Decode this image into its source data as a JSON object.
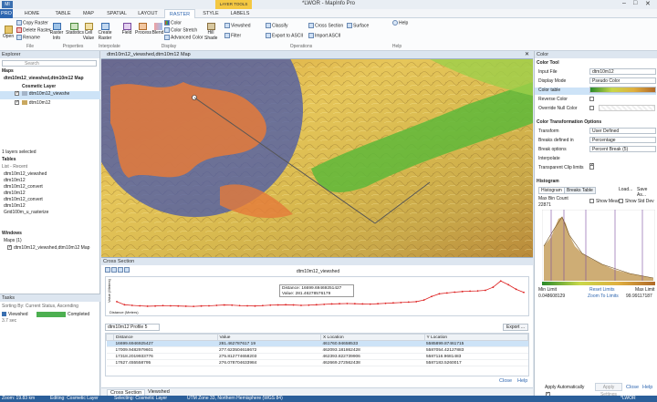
{
  "titlebar": {
    "app": "MI",
    "title": "*LWOR - MapInfo Pro",
    "context": "LAYER TOOLS"
  },
  "tabs": [
    "PRO",
    "HOME",
    "TABLE",
    "MAP",
    "SPATIAL",
    "LAYOUT",
    "RASTER",
    "STYLE",
    "LABELS"
  ],
  "help": "Help",
  "ribbon": {
    "copy": "Copy Raster",
    "delete": "Delete Raster",
    "rename": "Rename",
    "open": "Open",
    "info": "Raster Info",
    "stats": "Statistics",
    "cell": "Cell Value",
    "create": "Create Raster",
    "field": "Field",
    "process": "Process",
    "blend": "Blend",
    "color": "Color",
    "color_stretch": "Color Stretch",
    "advanced_color": "Advanced Color",
    "hill": "Hill Shade",
    "viewshed": "Viewshed",
    "filter": "Filter",
    "classify": "Classify",
    "export_ascii": "Export to ASCII",
    "cross": "Cross Section",
    "import_ascii": "Import ASCII",
    "surface": "Surface",
    "groups": [
      "File",
      "Properties",
      "Interpolate",
      "Display",
      "Operations",
      "Help"
    ]
  },
  "explorer": {
    "title": "Explorer",
    "search": "Search",
    "maps": "Maps",
    "map_name": "dtm10m12_viewshed,dtm10m12 Map",
    "cosmetic": "Cosmetic Layer",
    "layers": [
      "dtm10m12_viewshe",
      "dtm10m12"
    ],
    "selected": "1 layers selected",
    "tables": "Tables",
    "list": "List - Recent",
    "table_items": [
      "dtm10m12_viewshed",
      "dtm10m12",
      "dtm10m12_convert",
      "dtm10m12",
      "dtm10m12_convert",
      "dtm10m12",
      "Grid100m_u_rasterize"
    ],
    "windows": "Windows",
    "maps_count": "Maps (1)",
    "window_item": "dtm10m12_viewshed,dtm10m12 Map"
  },
  "tasks": {
    "title": "Tasks",
    "sort": "Sorting By: Current Status, Ascending",
    "name": "Viewshed",
    "time": "3.7 sec",
    "status": "Completed"
  },
  "map": {
    "tab": "dtm10m12_viewshed,dtm10m12 Map"
  },
  "cross": {
    "title": "Cross Section",
    "chart_title": "dtm10m12_viewshed",
    "ylabel": "Value (Metres)",
    "xlabel": "Distance (Meters)",
    "distance": "Distance: 16699.69469251427",
    "value": "Value: 281.46278576179",
    "profile": "dtm10m12 Profile 5",
    "export": "Export ...",
    "columns": [
      "Distance",
      "Value",
      "X Location",
      "Y Location"
    ],
    "rows": [
      [
        "16699.6946925427",
        "281.462787617 19",
        "461760.94658533",
        "5585899.87461715"
      ],
      [
        "17009.9482979601",
        "277.623504618672",
        "462093.181862428",
        "5587054.42127883"
      ],
      [
        "17318.2019933776",
        "275.812774658203",
        "462393.822739906",
        "5587116.9681483"
      ],
      [
        "17627.455558795",
        "276.078704633984",
        "462669.272562438",
        "5587183.5260017"
      ]
    ],
    "close": "Close",
    "help": "Help",
    "tab1": "Cross Section",
    "tab2": "Viewshed"
  },
  "color": {
    "title": "Color",
    "tool": "Color Tool",
    "input_file_label": "Input File",
    "input_file": "dtm10m12",
    "display_mode_label": "Display Mode",
    "display_mode": "Pseudo Color",
    "color_table_label": "Color table",
    "reverse_label": "Reverse Color",
    "override_label": "Override Null Color",
    "transform_section": "Color Transformation Options",
    "transform_label": "Transform",
    "transform": "User Defined",
    "breaks_label": "Breaks defined in",
    "breaks": "Percentage",
    "break_opts_label": "Break options",
    "break_opts": "Percent Break (5)",
    "interpolate_label": "Interpolate",
    "transparent_label": "Transparent Clip limits",
    "histogram_section": "Histogram",
    "hist_tab1": "Histogram",
    "hist_tab2": "Breaks Table",
    "load": "Load...",
    "save": "Save As...",
    "max_bin_label": "Max Bin Count",
    "max_bin": "22871",
    "show_mean": "Show Mean",
    "show_std": "Show Std Dev",
    "min_limit_label": "Min Limit",
    "min_limit": "0.048608129",
    "max_limit_label": "Max Limit",
    "max_limit": "99.99117187",
    "reset": "Reset Limits",
    "zoom": "Zoom To Limits",
    "apply_auto": "Apply Automatically",
    "apply": "Apply Settings",
    "close": "Close",
    "help": "Help"
  },
  "status": {
    "zoom": "Zoom: 19.83 km",
    "editing": "Editing: Cosmetic Layer",
    "selecting": "Selecting: Cosmetic Layer",
    "proj": "UTM Zone 33, Northern Hemisphere (WGS 84)",
    "doc": "*LWOR"
  },
  "chart_data": {
    "type": "line",
    "title": "dtm10m12_viewshed",
    "ylabel": "Value (Metres)",
    "xlabel": "Distance (Meters)",
    "series": [
      {
        "values": [
          230,
          215,
          212,
          210,
          208,
          209,
          211,
          210,
          209,
          208,
          207,
          209,
          210,
          212,
          214,
          213,
          211,
          210,
          209,
          211,
          213,
          214,
          215,
          214,
          212,
          213,
          215,
          217,
          219,
          220,
          221,
          220,
          219,
          218,
          220,
          222,
          224,
          226,
          228,
          230,
          238,
          255,
          268,
          272,
          276,
          279,
          281,
          282,
          285,
          300,
          330,
          312,
          290,
          275
        ]
      }
    ]
  }
}
